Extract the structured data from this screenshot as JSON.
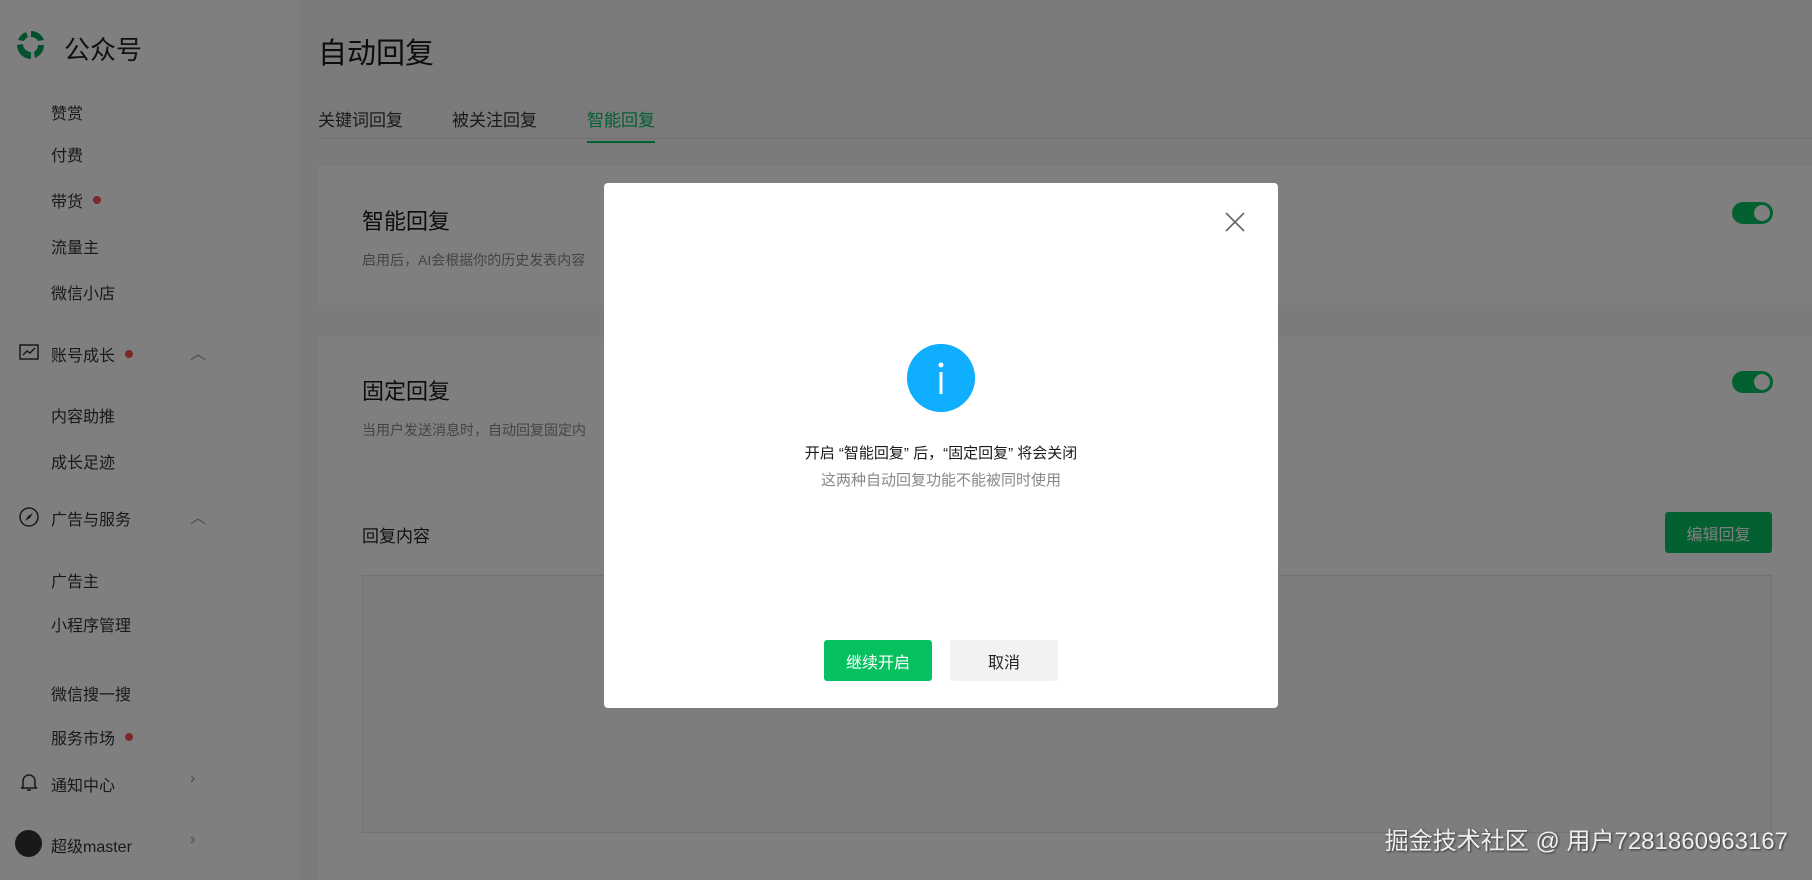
{
  "sidebar": {
    "brand": "公众号",
    "items": [
      {
        "label": "赞赏"
      },
      {
        "label": "付费"
      },
      {
        "label": "带货",
        "dot": true
      },
      {
        "label": "流量主"
      },
      {
        "label": "微信小店"
      },
      {
        "label": "账号成长",
        "dot": true,
        "icon": "chart-icon"
      },
      {
        "label": "内容助推"
      },
      {
        "label": "成长足迹"
      },
      {
        "label": "广告与服务",
        "icon": "compass-icon"
      },
      {
        "label": "广告主"
      },
      {
        "label": "小程序管理"
      },
      {
        "label": "微信搜一搜"
      },
      {
        "label": "服务市场",
        "dot": true
      },
      {
        "label": "通知中心",
        "icon": "bell-icon"
      },
      {
        "label": "超级master",
        "icon": "avatar"
      }
    ]
  },
  "main": {
    "title": "自动回复",
    "tabs": [
      {
        "label": "关键词回复"
      },
      {
        "label": "被关注回复"
      },
      {
        "label": "智能回复",
        "active": true
      }
    ],
    "smart": {
      "title": "智能回复",
      "desc": "启用后，AI会根据你的历史发表内容",
      "enabled": true
    },
    "fixed": {
      "title": "固定回复",
      "desc": "当用户发送消息时，自动回复固定内",
      "enabled": true,
      "content_label": "回复内容",
      "edit_label": "编辑回复"
    }
  },
  "dialog": {
    "message": "开启 “智能回复” 后，“固定回复” 将会关闭",
    "sub": "这两种自动回复功能不能被同时使用",
    "confirm": "继续开启",
    "cancel": "取消"
  },
  "watermark": "掘金技术社区 @ 用户7281860963167",
  "colors": {
    "accent": "#07c160",
    "info": "#10aeff",
    "badge": "#fa5151"
  }
}
